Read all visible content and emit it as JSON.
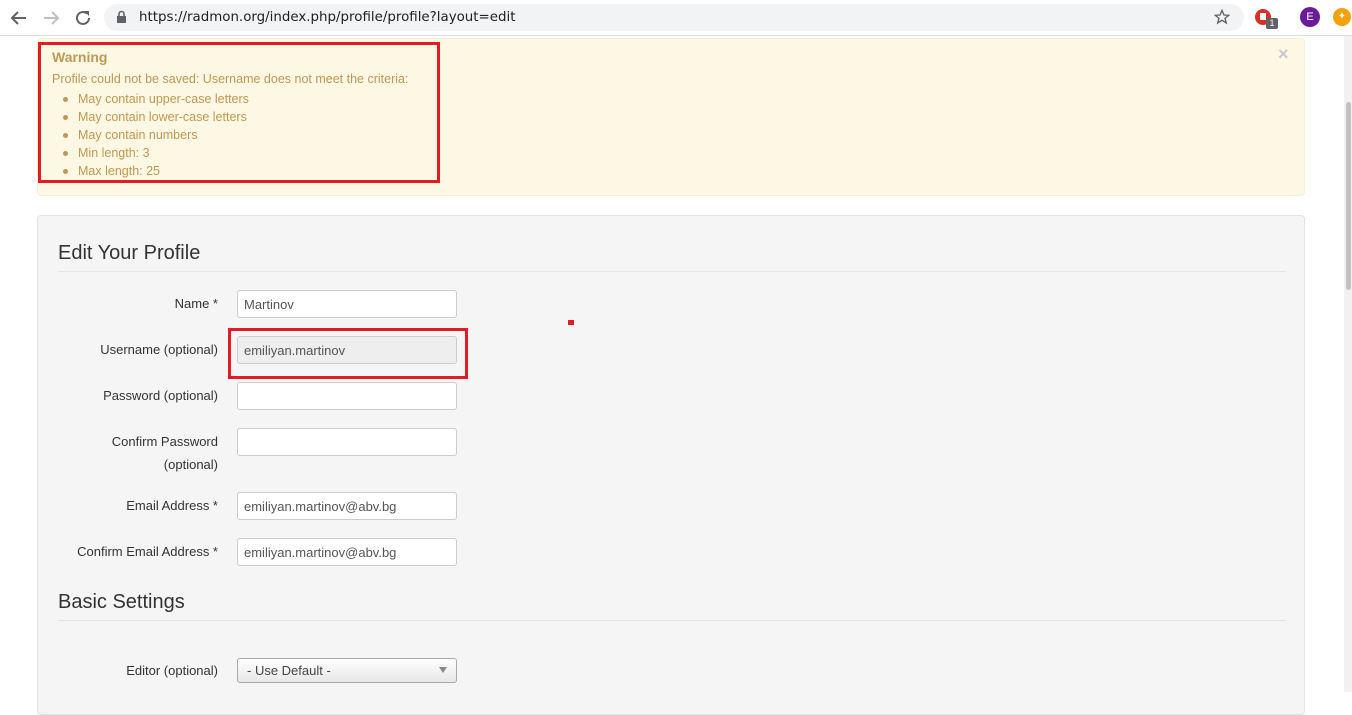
{
  "browser": {
    "url": "https://radmon.org/index.php/profile/profile?layout=edit",
    "extension_badge": "1",
    "avatar_letter": "E"
  },
  "alert": {
    "title": "Warning",
    "message": "Profile could not be saved: Username does not meet the criteria:",
    "criteria": [
      "May contain upper-case letters",
      "May contain lower-case letters",
      "May contain numbers",
      "Min length: 3",
      "Max length: 25"
    ],
    "close": "×"
  },
  "profile": {
    "heading": "Edit Your Profile",
    "fields": {
      "name": {
        "label": "Name *",
        "value": "Martinov"
      },
      "username": {
        "label": "Username (optional)",
        "value": "emiliyan.martinov"
      },
      "password": {
        "label": "Password (optional)",
        "value": ""
      },
      "confirm_password": {
        "label_line1": "Confirm Password",
        "label_line2": "(optional)",
        "value": ""
      },
      "email": {
        "label": "Email Address *",
        "value": "emiliyan.martinov@abv.bg"
      },
      "confirm_email": {
        "label": "Confirm Email Address *",
        "value": "emiliyan.martinov@abv.bg"
      }
    }
  },
  "basic": {
    "heading": "Basic Settings",
    "editor": {
      "label": "Editor (optional)",
      "value": "- Use Default -"
    }
  }
}
